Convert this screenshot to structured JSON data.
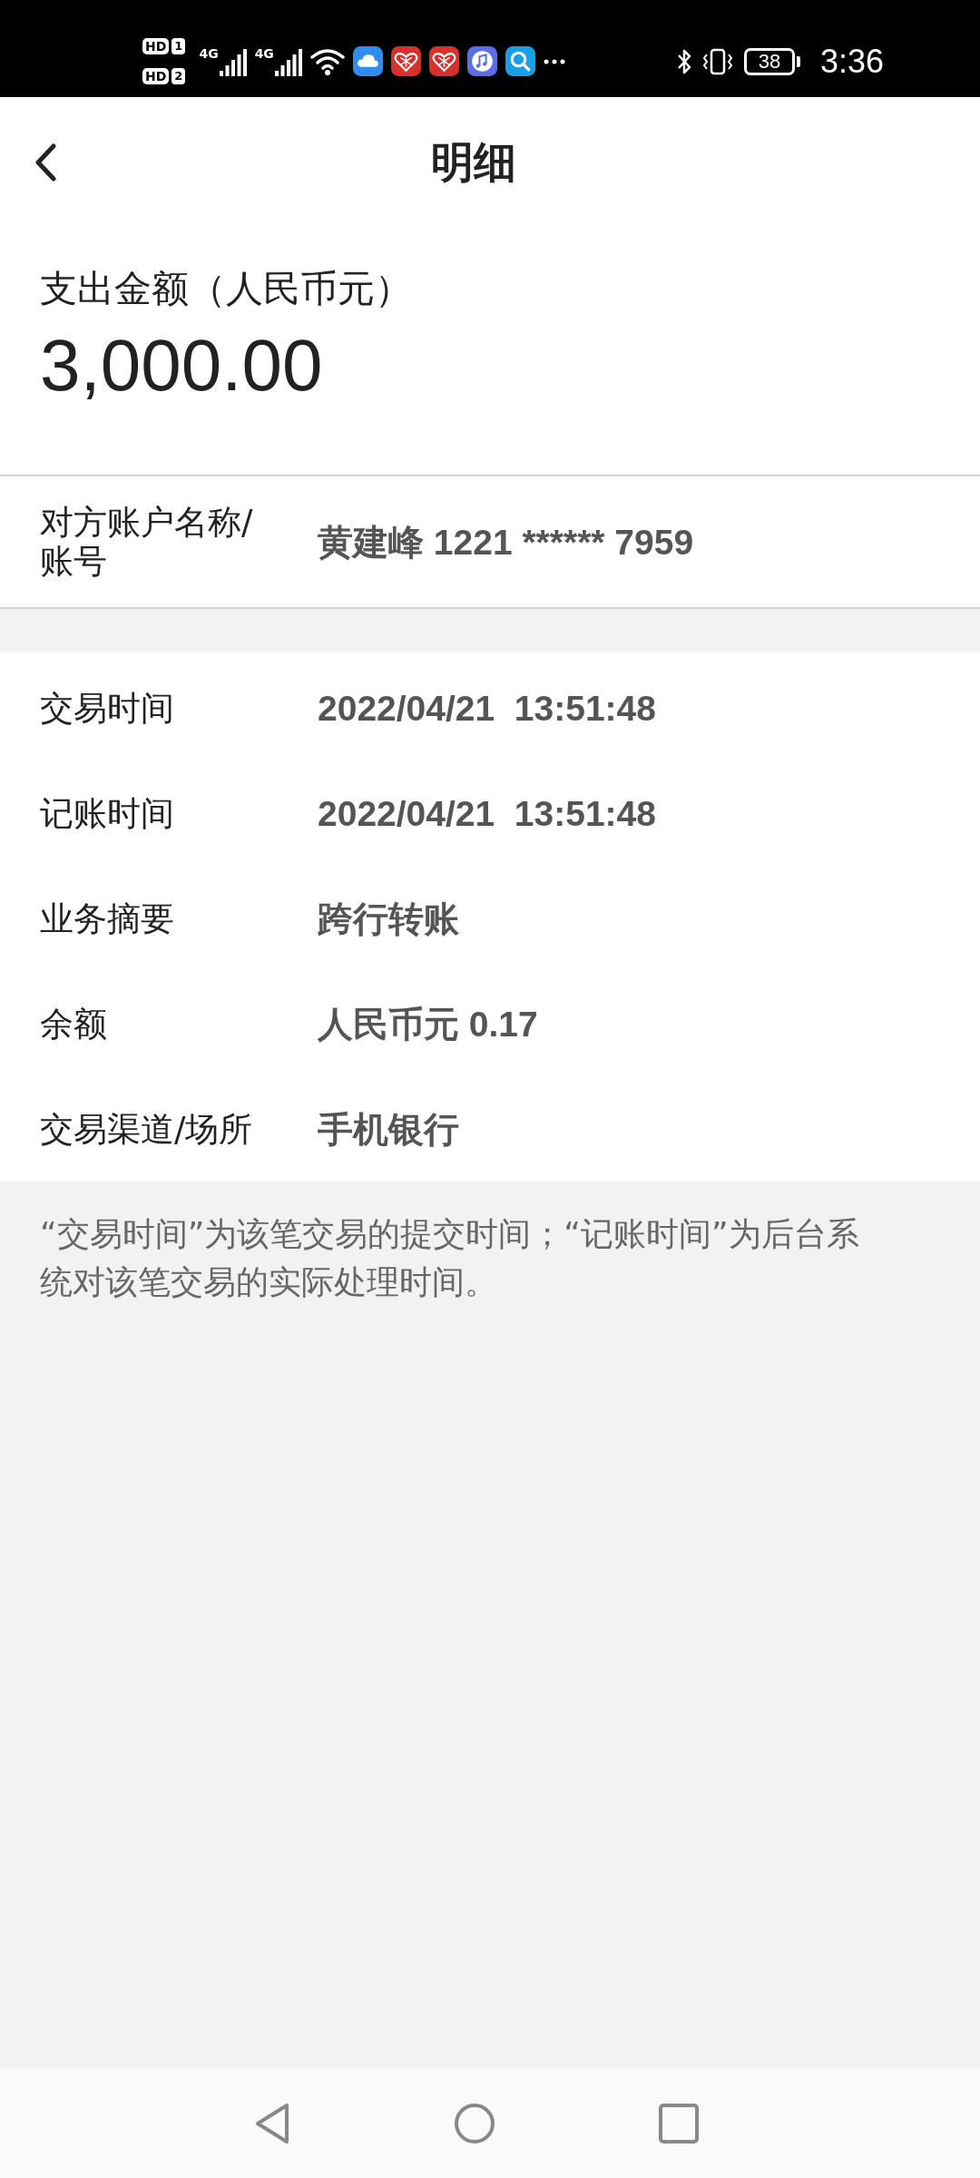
{
  "status_bar": {
    "sims": [
      {
        "badge": "HD",
        "slot": "1"
      },
      {
        "badge": "HD",
        "slot": "2"
      }
    ],
    "networks": [
      {
        "type": "4G"
      },
      {
        "type": "4G"
      }
    ],
    "battery": "38",
    "time": "3:36"
  },
  "header": {
    "title": "明细"
  },
  "amount": {
    "label": "支出金额（人民币元）",
    "value": "3,000.00"
  },
  "counterparty": {
    "label": "对方账户名称/账号",
    "value": "黄建峰 1221 ****** 7959"
  },
  "details": [
    {
      "label": "交易时间",
      "value": "2022/04/21  13:51:48"
    },
    {
      "label": "记账时间",
      "value": "2022/04/21  13:51:48"
    },
    {
      "label": "业务摘要",
      "value": "跨行转账"
    },
    {
      "label": "余额",
      "value": "人民币元 0.17"
    },
    {
      "label": "交易渠道/场所",
      "value": "手机银行"
    }
  ],
  "note": "“交易时间”为该笔交易的提交时间；“记账时间”为后台系统对该笔交易的实际处理时间。"
}
